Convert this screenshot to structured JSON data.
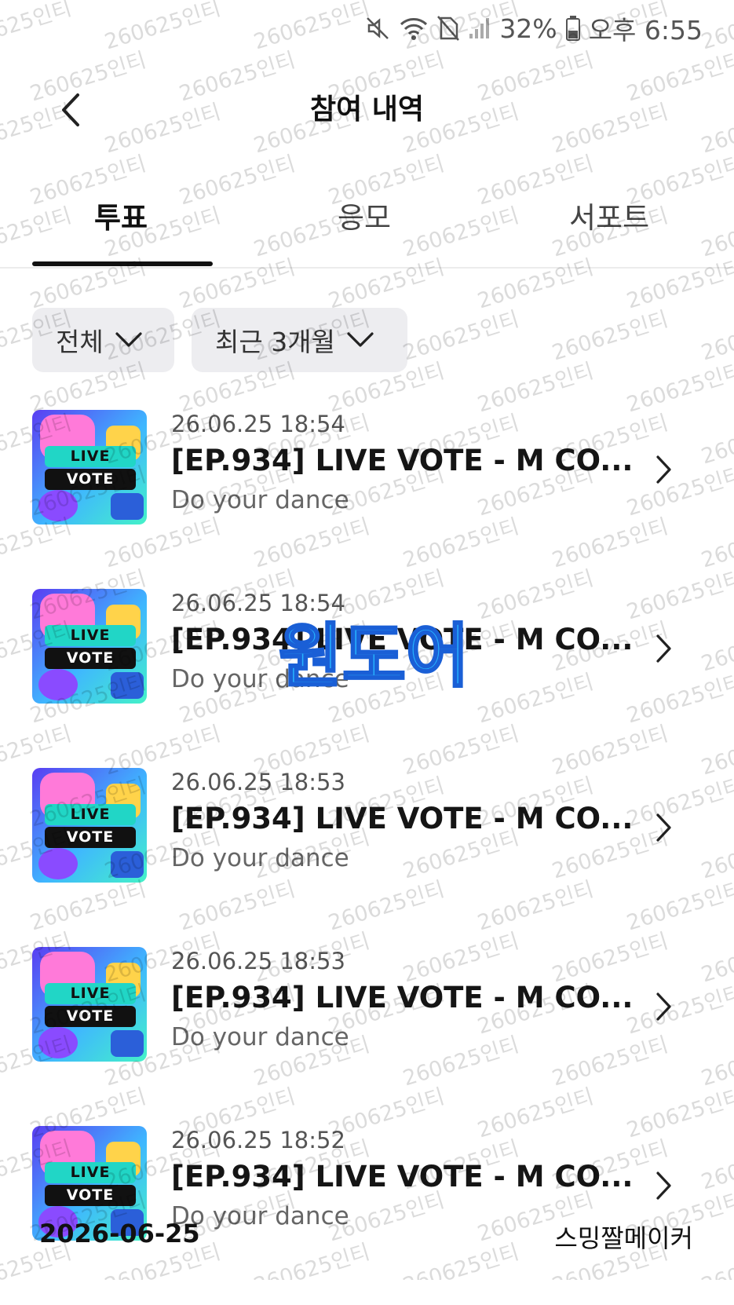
{
  "status_bar": {
    "battery": "32%",
    "time": "오후 6:55"
  },
  "header": {
    "title": "참여 내역"
  },
  "tabs": [
    {
      "label": "투표",
      "active": true
    },
    {
      "label": "응모",
      "active": false
    },
    {
      "label": "서포트",
      "active": false
    }
  ],
  "filters": {
    "category": "전체",
    "period": "최근 3개월"
  },
  "list": [
    {
      "date": "26.06.25 18:54",
      "title": "[EP.934] LIVE VOTE - M CO...",
      "subtitle": "Do your dance"
    },
    {
      "date": "26.06.25 18:54",
      "title": "[EP.934] LIVE VOTE - M CO...",
      "subtitle": "Do your dance"
    },
    {
      "date": "26.06.25 18:53",
      "title": "[EP.934] LIVE VOTE - M CO...",
      "subtitle": "Do your dance"
    },
    {
      "date": "26.06.25 18:53",
      "title": "[EP.934] LIVE VOTE - M CO...",
      "subtitle": "Do your dance"
    },
    {
      "date": "26.06.25 18:52",
      "title": "[EP.934] LIVE VOTE - M CO...",
      "subtitle": "Do your dance"
    }
  ],
  "thumbnail_text": {
    "line1": "LIVE",
    "line2": "VOTE"
  },
  "overlay": {
    "stamp": "원도어",
    "watermark": "260625인티",
    "footer_date": "2026-06-25",
    "footer_maker": "스밍짤메이커"
  },
  "colors": {
    "accent": "#111111",
    "chip_bg": "#ededf0",
    "stamp": "#27b3ff"
  }
}
